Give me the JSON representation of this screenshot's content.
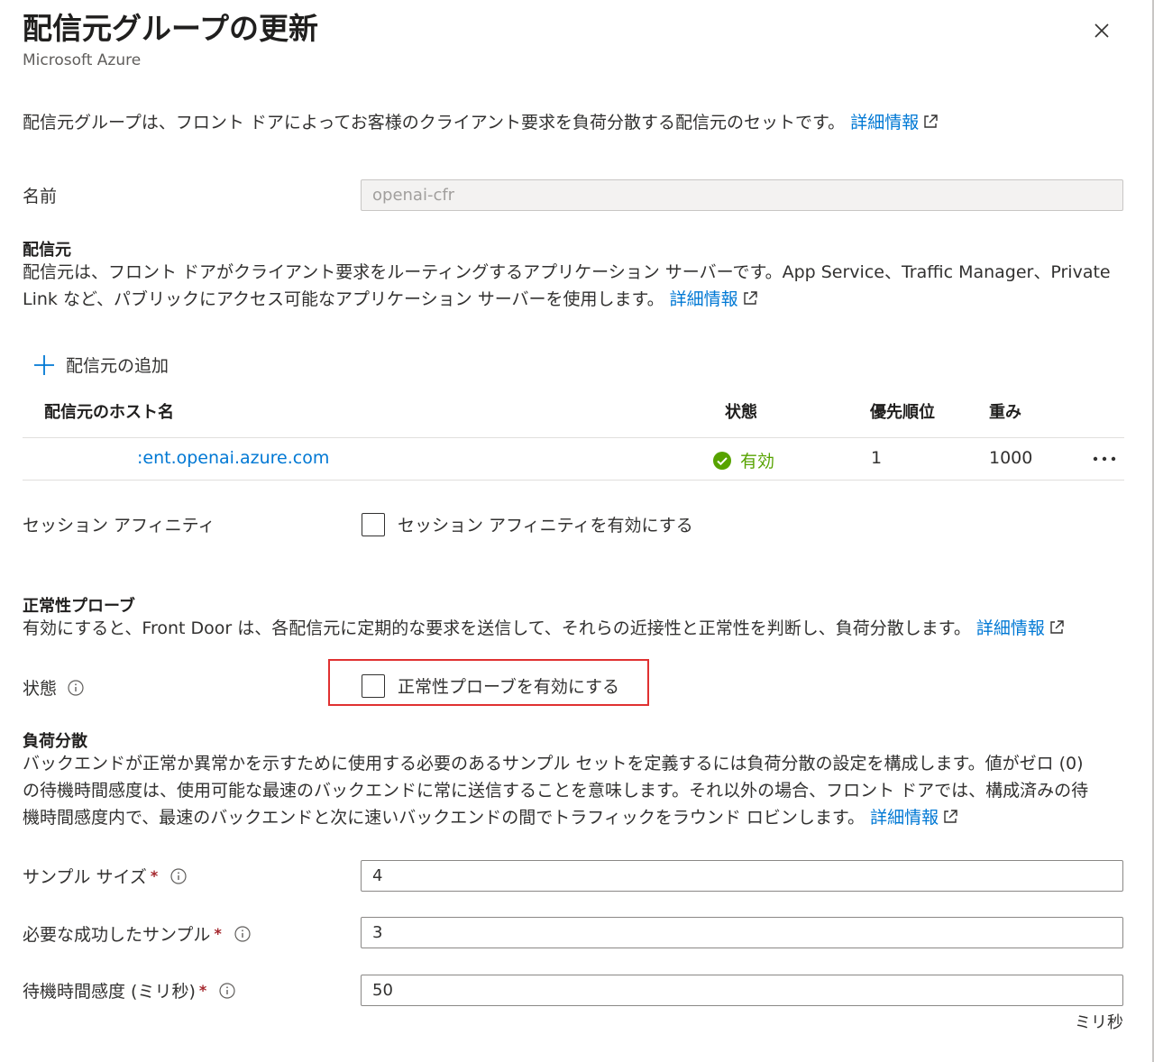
{
  "header": {
    "title": "配信元グループの更新",
    "subtitle": "Microsoft Azure"
  },
  "intro": {
    "text": "配信元グループは、フロント ドアによってお客様のクライアント要求を負荷分散する配信元のセットです。",
    "link": "詳細情報"
  },
  "name_field": {
    "label": "名前",
    "value": "openai-cfr"
  },
  "origins": {
    "heading": "配信元",
    "desc_line1": "配信元は、フロント ドアがクライアント要求をルーティングするアプリケーション サーバーです。App Service、Traffic Manager、Private",
    "desc_line2": "Link など、パブリックにアクセス可能なアプリケーション サーバーを使用します。",
    "link": "詳細情報",
    "add_label": "配信元の追加",
    "columns": [
      "配信元のホスト名",
      "状態",
      "優先順位",
      "重み"
    ],
    "rows": [
      {
        "host": ":ent.openai.azure.com",
        "status": "有効",
        "priority": "1",
        "weight": "1000"
      }
    ]
  },
  "session": {
    "label": "セッション アフィニティ",
    "checkbox_label": "セッション アフィニティを有効にする"
  },
  "health_probe": {
    "heading": "正常性プローブ",
    "desc": "有効にすると、Front Door は、各配信元に定期的な要求を送信して、それらの近接性と正常性を判断し、負荷分散します。",
    "link": "詳細情報",
    "state_label": "状態",
    "checkbox_label": "正常性プローブを有効にする"
  },
  "load_balancing": {
    "heading": "負荷分散",
    "desc_line1": "バックエンドが正常か異常かを示すために使用する必要のあるサンプル セットを定義するには負荷分散の設定を構成します。値がゼロ (0)",
    "desc_line2": "の待機時間感度は、使用可能な最速のバックエンドに常に送信することを意味します。それ以外の場合、フロント ドアでは、構成済みの待",
    "desc_line3": "機時間感度内で、最速のバックエンドと次に速いバックエンドの間でトラフィックをラウンド ロビンします。",
    "link": "詳細情報",
    "sample_size": {
      "label": "サンプル サイズ",
      "value": "4"
    },
    "successful_samples": {
      "label": "必要な成功したサンプル",
      "value": "3"
    },
    "latency": {
      "label": "待機時間感度 (ミリ秒)",
      "value": "50",
      "unit": "ミリ秒"
    }
  },
  "colors": {
    "link": "#0078d4",
    "status_ok": "#57a300",
    "required": "#a4262c",
    "highlight": "#e03131"
  }
}
